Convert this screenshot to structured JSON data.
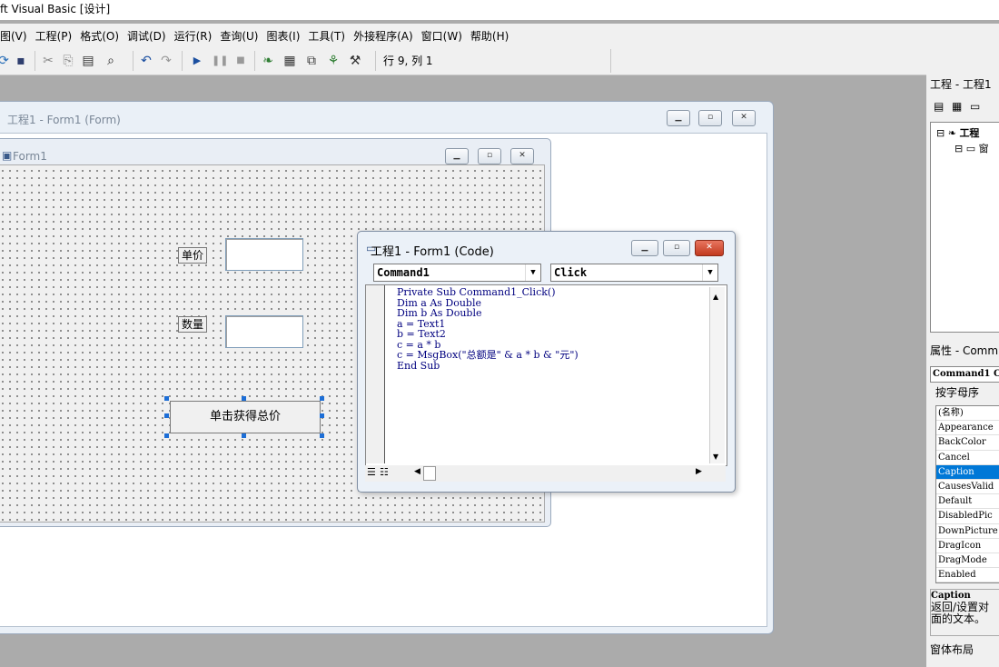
{
  "window": {
    "title": "ft Visual Basic [设计]"
  },
  "menu": [
    "图(V)",
    "工程(P)",
    "格式(O)",
    "调试(D)",
    "运行(R)",
    "查询(U)",
    "图表(I)",
    "工具(T)",
    "外接程序(A)",
    "窗口(W)",
    "帮助(H)"
  ],
  "toolbar": {
    "row_col": "行 9, 列 1"
  },
  "designer": {
    "title": "工程1 - Form1 (Form)"
  },
  "form": {
    "title": "Form1",
    "label_price": "单价",
    "label_qty": "数量",
    "button_caption": "单击获得总价"
  },
  "code_window": {
    "title": "工程1 - Form1 (Code)",
    "object_combo": "Command1",
    "proc_combo": "Click",
    "code": "Private Sub Command1_Click()\nDim a As Double\nDim b As Double\na = Text1\nb = Text2\nc = a * b\nc = MsgBox(\"总额是\" & a * b & \"元\")\nEnd Sub"
  },
  "project_panel": {
    "title": "工程 - 工程1",
    "tree_root": "工程",
    "tree_child": "窗"
  },
  "properties_panel": {
    "title": "属性 - Comm",
    "object": "Command1 C",
    "tab_alpha": "按字母序",
    "rows": [
      "(名称)",
      "Appearance",
      "BackColor",
      "Cancel",
      "Caption",
      "CausesValid",
      "Default",
      "DisabledPic",
      "DownPicture",
      "DragIcon",
      "DragMode",
      "Enabled"
    ],
    "selected_row": "Caption",
    "desc_title": "Caption",
    "desc_text": "返回/设置对面的文本。"
  },
  "layout_panel": {
    "title": "窗体布局"
  }
}
